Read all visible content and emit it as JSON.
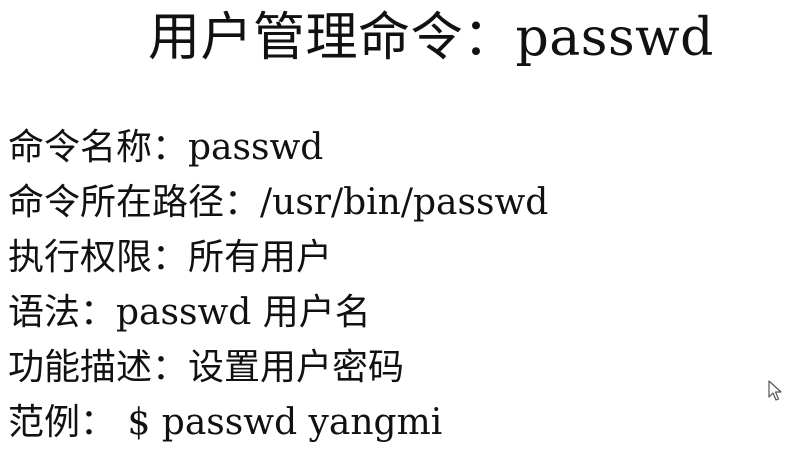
{
  "slide": {
    "title": "用户管理命令：passwd",
    "lines": [
      "命令名称：passwd",
      "命令所在路径：/usr/bin/passwd",
      "执行权限：所有用户",
      "语法：passwd 用户名",
      "功能描述：设置用户密码",
      "范例：  $ passwd yangmi"
    ]
  },
  "icons": {
    "cursor": "mouse-pointer-icon"
  }
}
